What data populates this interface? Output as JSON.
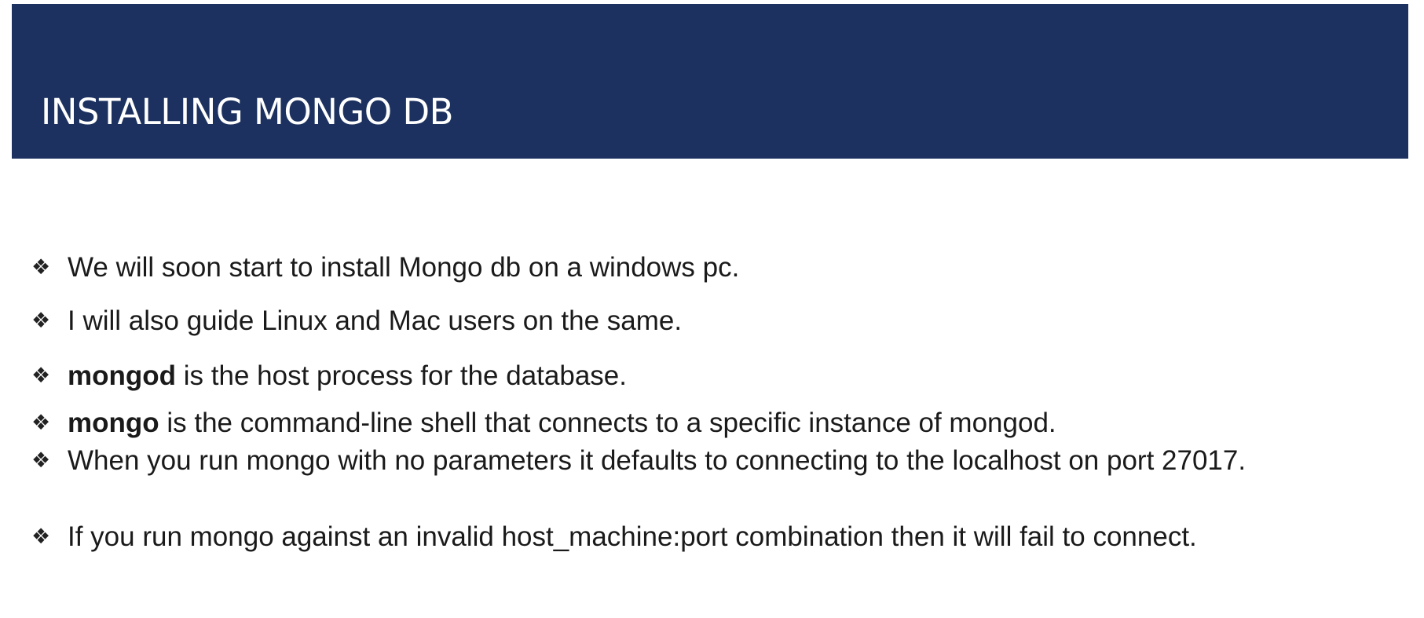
{
  "title": "INSTALLING MONGO DB",
  "bullet_marker": "❖",
  "bullets": [
    {
      "strong": "",
      "text": "We will soon start to install Mongo db on a windows pc."
    },
    {
      "strong": "",
      "text": "I will also guide Linux and Mac users on the same."
    },
    {
      "strong": "mongod",
      "text": " is the host process for the database."
    },
    {
      "strong": "mongo",
      "text": " is the command-line shell that connects to a specific instance of mongod."
    },
    {
      "strong": "",
      "text": "When you run mongo with no parameters it defaults to connecting to the localhost on port 27017."
    },
    {
      "strong": "",
      "text": "If you run mongo against an invalid host_machine:port combination then it will fail to connect."
    }
  ],
  "colors": {
    "title_bar": "#1c315f",
    "title_text": "#ffffff",
    "body_text": "#1a1a1a"
  }
}
